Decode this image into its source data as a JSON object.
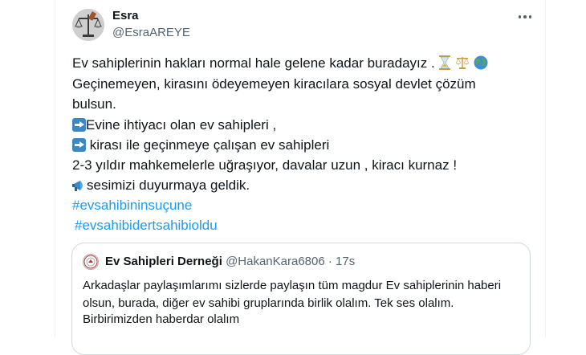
{
  "tweet": {
    "author_name": "Esra",
    "author_handle": "@EsraAREYE",
    "more_icon": "more-horizontal-icon",
    "lines": {
      "line1": "Ev sahiplerinin hakları normal hale gelene kadar buradayız .",
      "line2": "Geçinemeyen, kirasını ödeyemeyen kiracılara sosyal devlet çözüm",
      "line3": "bulsun.",
      "line4": "Evine ihtiyacı olan ev sahipleri ,",
      "line5": " kirası ile geçinmeye çalışan ev sahipleri",
      "line6": "2-3 yıldır mahkemelerle uğraşıyor, davalar uzun , kiracı kurnaz !",
      "line7": "sesimizi duyurmaya geldik."
    },
    "emojis": [
      "hourglass-icon",
      "scales-icon",
      "globe-icon",
      "right-arrow-icon",
      "megaphone-icon"
    ],
    "hashtags": [
      "#evsahibininsuçune",
      "#evsahibidertsahibioldu"
    ]
  },
  "quote": {
    "name": "Ev Sahipleri Derneği",
    "handle": "@HakanKara6806",
    "separator": "·",
    "time": "17s",
    "lines": [
      "Arkadaşlar paylaşımlarımı sizlerde paylaşın tüm magdur Ev sahiplerinin haberi",
      "olsun, burada, diğer ev sahibi gruplarında birlik olalım. Tek ses olalım.",
      "Birbirimizden haberdar olalım"
    ]
  },
  "colors": {
    "link": "#1d9bf0",
    "secondary_text": "#536471",
    "border": "#cfd9de",
    "arrow_emoji_bg": "#3b88c3"
  }
}
